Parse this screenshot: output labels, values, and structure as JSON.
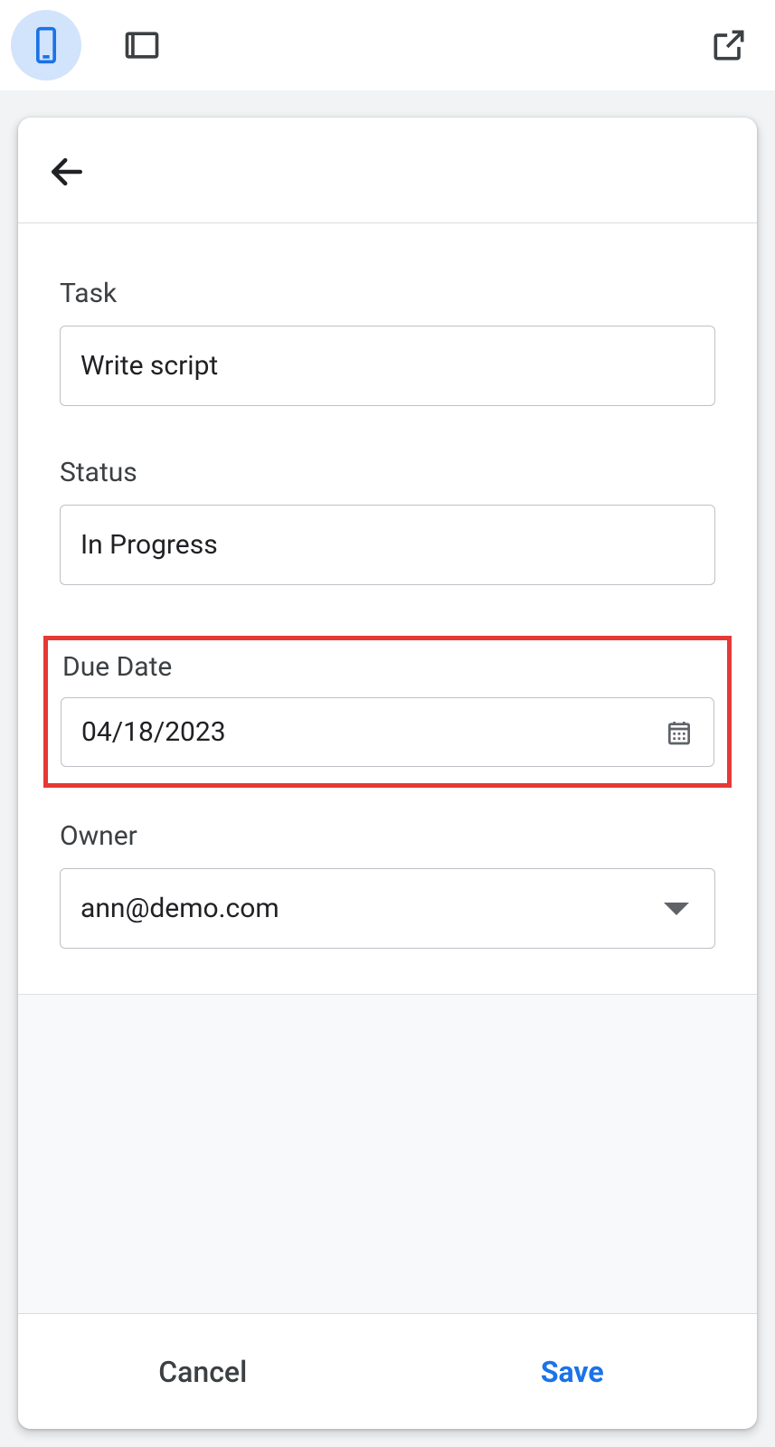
{
  "toolbar": {
    "mobile_icon": "phone-icon",
    "tablet_icon": "tablet-icon",
    "open_icon": "open-external-icon"
  },
  "form": {
    "task": {
      "label": "Task",
      "value": "Write script"
    },
    "status": {
      "label": "Status",
      "value": "In Progress"
    },
    "due_date": {
      "label": "Due Date",
      "value": "04/18/2023"
    },
    "owner": {
      "label": "Owner",
      "value": "ann@demo.com"
    }
  },
  "footer": {
    "cancel_label": "Cancel",
    "save_label": "Save"
  }
}
